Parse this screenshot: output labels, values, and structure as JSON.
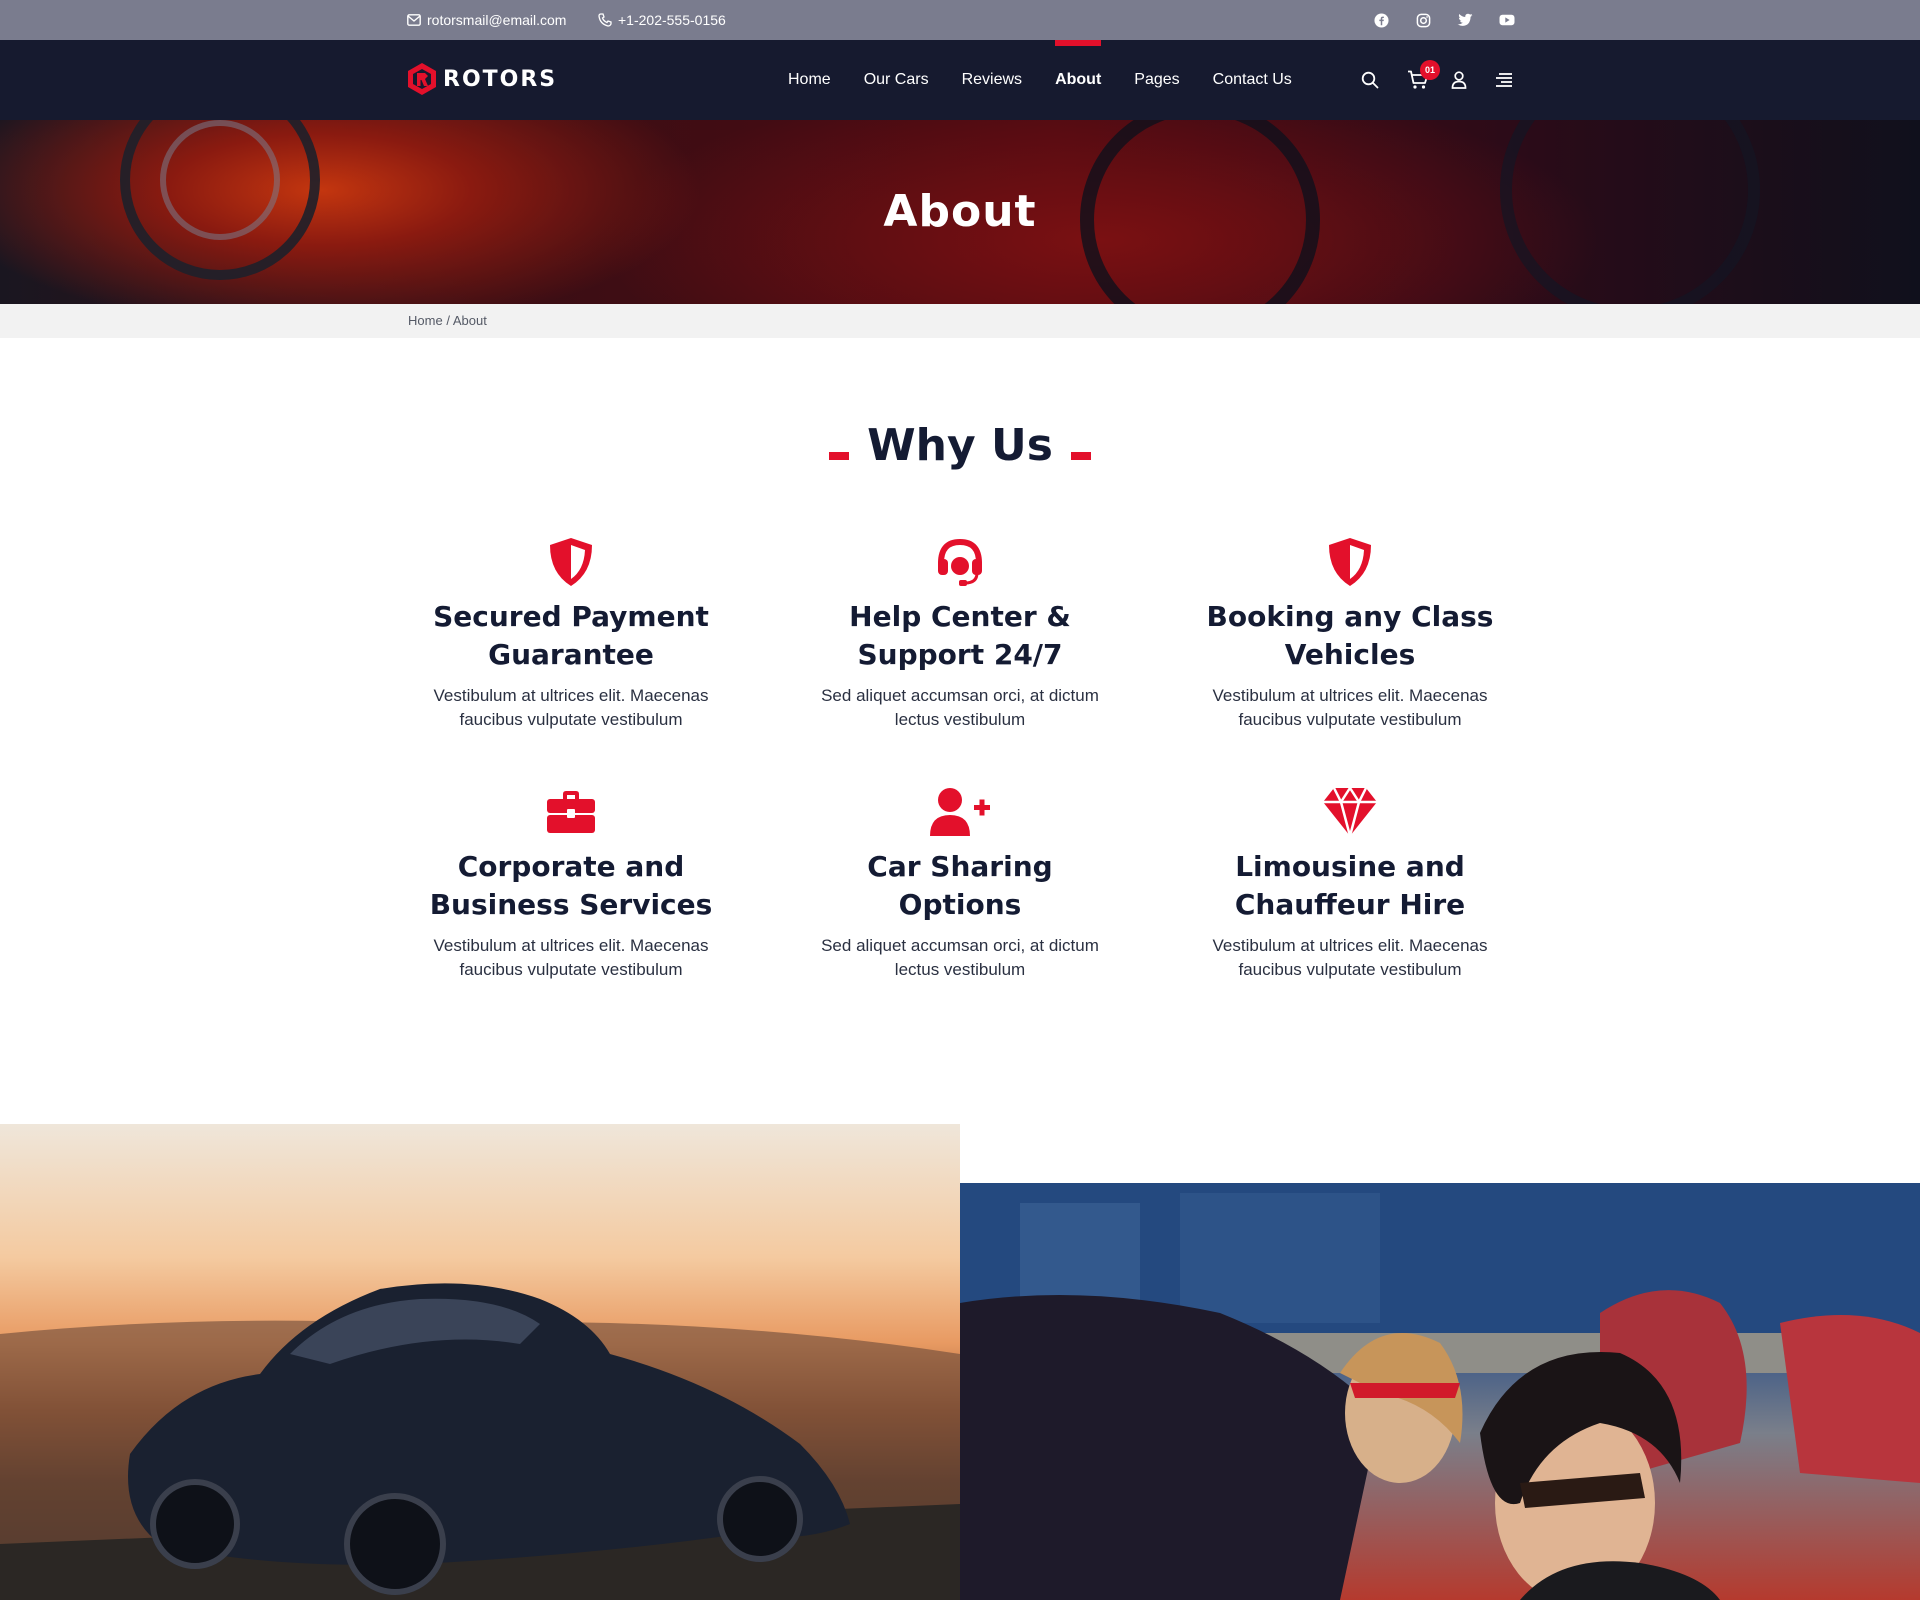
{
  "topbar": {
    "email": "rotorsmail@email.com",
    "phone": "+1-202-555-0156",
    "socials": [
      "facebook-icon",
      "instagram-icon",
      "twitter-icon",
      "youtube-icon"
    ]
  },
  "nav": {
    "logo_text": "ROTORS",
    "links": [
      "Home",
      "Our Cars",
      "Reviews",
      "About",
      "Pages",
      "Contact Us"
    ],
    "active_link": "About",
    "cart_count": "01",
    "icons": [
      "search-icon",
      "cart-icon",
      "user-icon",
      "menu-icon"
    ]
  },
  "hero": {
    "title": "About"
  },
  "breadcrumb": {
    "home": "Home",
    "separator": "/",
    "current": "About"
  },
  "why_us": {
    "title": "Why Us",
    "features": [
      {
        "icon": "shield-icon",
        "title_l1": "Secured Payment",
        "title_l2": "Guarantee",
        "desc_l1": "Vestibulum at ultrices elit. Maecenas",
        "desc_l2": "faucibus vulputate vestibulum"
      },
      {
        "icon": "headset-icon",
        "title_l1": "Help Center &",
        "title_l2": "Support 24/7",
        "desc_l1": "Sed aliquet accumsan orci, at dictum",
        "desc_l2": "lectus vestibulum"
      },
      {
        "icon": "shield-icon",
        "title_l1": "Booking any Class",
        "title_l2": "Vehicles",
        "desc_l1": "Vestibulum at ultrices elit. Maecenas",
        "desc_l2": "faucibus vulputate vestibulum"
      },
      {
        "icon": "briefcase-icon",
        "title_l1": "Corporate and",
        "title_l2": "Business Services",
        "desc_l1": "Vestibulum at ultrices elit. Maecenas",
        "desc_l2": "faucibus vulputate vestibulum"
      },
      {
        "icon": "user-plus-icon",
        "title_l1": "Car Sharing",
        "title_l2": "Options",
        "desc_l1": "Sed aliquet accumsan orci, at dictum",
        "desc_l2": "lectus vestibulum"
      },
      {
        "icon": "diamond-icon",
        "title_l1": "Limousine and",
        "title_l2": "Chauffeur Hire",
        "desc_l1": "Vestibulum at ultrices elit. Maecenas",
        "desc_l2": "faucibus vulputate vestibulum"
      }
    ]
  },
  "colors": {
    "accent": "#e3102b",
    "navy": "#141b33",
    "topbar": "#7a7c8e",
    "navbar": "#161a2f"
  }
}
